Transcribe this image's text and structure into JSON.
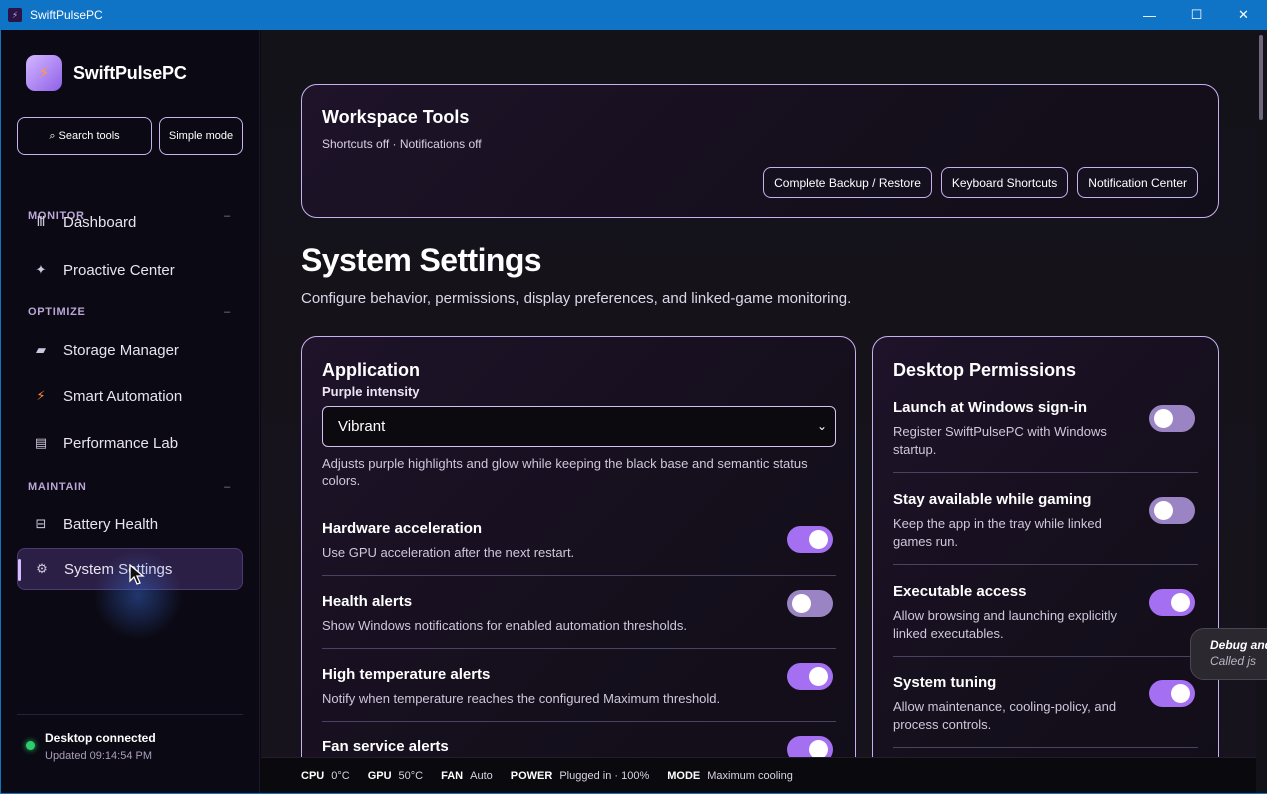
{
  "window": {
    "title": "SwiftPulsePC",
    "minimize_glyph": "—",
    "maximize_glyph": "☐",
    "close_glyph": "✕"
  },
  "sidebar": {
    "brand": "SwiftPulsePC",
    "brand_icon": "bolt-icon",
    "search_label": "⌕ Search tools",
    "simple_mode_label": "Simple mode",
    "sections": [
      {
        "title": "MONITOR",
        "collapse": "–"
      },
      {
        "title": "OPTIMIZE",
        "collapse": "–"
      },
      {
        "title": "MAINTAIN",
        "collapse": "–"
      }
    ],
    "items": [
      {
        "label": "Dashboard",
        "icon": "Ⅲ"
      },
      {
        "label": "Proactive Center",
        "icon": "✦"
      },
      {
        "label": "Storage Manager",
        "icon": "▰"
      },
      {
        "label": "Smart Automation",
        "icon": "⚡"
      },
      {
        "label": "Performance Lab",
        "icon": "▤"
      },
      {
        "label": "Battery Health",
        "icon": "⊟"
      },
      {
        "label": "System Settings",
        "icon": "⚙"
      }
    ],
    "connection": {
      "title": "Desktop connected",
      "updated": "Updated 09:14:54 PM",
      "status_color": "#2ccf6b"
    }
  },
  "workspace_tools": {
    "title": "Workspace Tools",
    "subtitle": "Shortcuts off · Notifications off",
    "buttons": [
      "Complete Backup / Restore",
      "Keyboard Shortcuts",
      "Notification Center"
    ]
  },
  "page": {
    "title": "System Settings",
    "subtitle": "Configure behavior, permissions, display preferences, and linked-game monitoring."
  },
  "application": {
    "title": "Application",
    "intensity_label": "Purple intensity",
    "intensity_value": "Vibrant",
    "intensity_help": "Adjusts purple highlights and glow while keeping the black base and semantic status colors.",
    "settings": [
      {
        "title": "Hardware acceleration",
        "desc": "Use GPU acceleration after the next restart.",
        "on": true
      },
      {
        "title": "Health alerts",
        "desc": "Show Windows notifications for enabled automation thresholds.",
        "on": false
      },
      {
        "title": "High temperature alerts",
        "desc": "Notify when temperature reaches the configured Maximum threshold.",
        "on": true
      },
      {
        "title": "Fan service alerts",
        "desc": "",
        "on": true
      }
    ]
  },
  "permissions": {
    "title": "Desktop Permissions",
    "settings": [
      {
        "title": "Launch at Windows sign-in",
        "desc": "Register SwiftPulsePC with Windows startup.",
        "on": false
      },
      {
        "title": "Stay available while gaming",
        "desc": "Keep the app in the tray while linked games run.",
        "on": false
      },
      {
        "title": "Executable access",
        "desc": "Allow browsing and launching explicitly linked executables.",
        "on": true
      },
      {
        "title": "System tuning",
        "desc": "Allow maintenance, cooling-policy, and process controls.",
        "on": true
      }
    ]
  },
  "debug": {
    "line1": "Debug and",
    "line2": "Called js"
  },
  "statusbar": {
    "cpu_key": "CPU",
    "cpu_val": "0°C",
    "gpu_key": "GPU",
    "gpu_val": "50°C",
    "fan_key": "FAN",
    "fan_val": "Auto",
    "power_key": "POWER",
    "power_val": "Plugged in · 100%",
    "mode_key": "MODE",
    "mode_val": "Maximum cooling"
  },
  "colors": {
    "accent": "#a46ff0",
    "toggle_off": "#9a84c3",
    "titlebar": "#0f73c6"
  }
}
